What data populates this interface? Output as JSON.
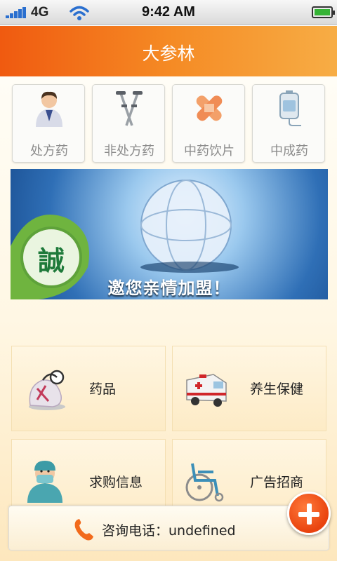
{
  "status": {
    "network": "4G",
    "time": "9:42 AM"
  },
  "header": {
    "title": "大参林"
  },
  "categories": [
    {
      "label": "处方药",
      "icon": "doctor-icon"
    },
    {
      "label": "非处方药",
      "icon": "crutches-icon"
    },
    {
      "label": "中药饮片",
      "icon": "bandage-icon"
    },
    {
      "label": "中成药",
      "icon": "iv-bag-icon"
    }
  ],
  "banner": {
    "text": "邀您亲情加盟！",
    "emblem": "誠"
  },
  "menu": [
    {
      "label": "药品",
      "icon": "medicine-bag-icon"
    },
    {
      "label": "养生保健",
      "icon": "ambulance-icon"
    },
    {
      "label": "求购信息",
      "icon": "surgeon-icon"
    },
    {
      "label": "广告招商",
      "icon": "wheelchair-icon"
    }
  ],
  "footer": {
    "label": "咨询电话：undefined"
  },
  "colors": {
    "accent": "#f26a1b",
    "title_gradient_start": "#f05a10",
    "title_gradient_end": "#f7ad45"
  }
}
